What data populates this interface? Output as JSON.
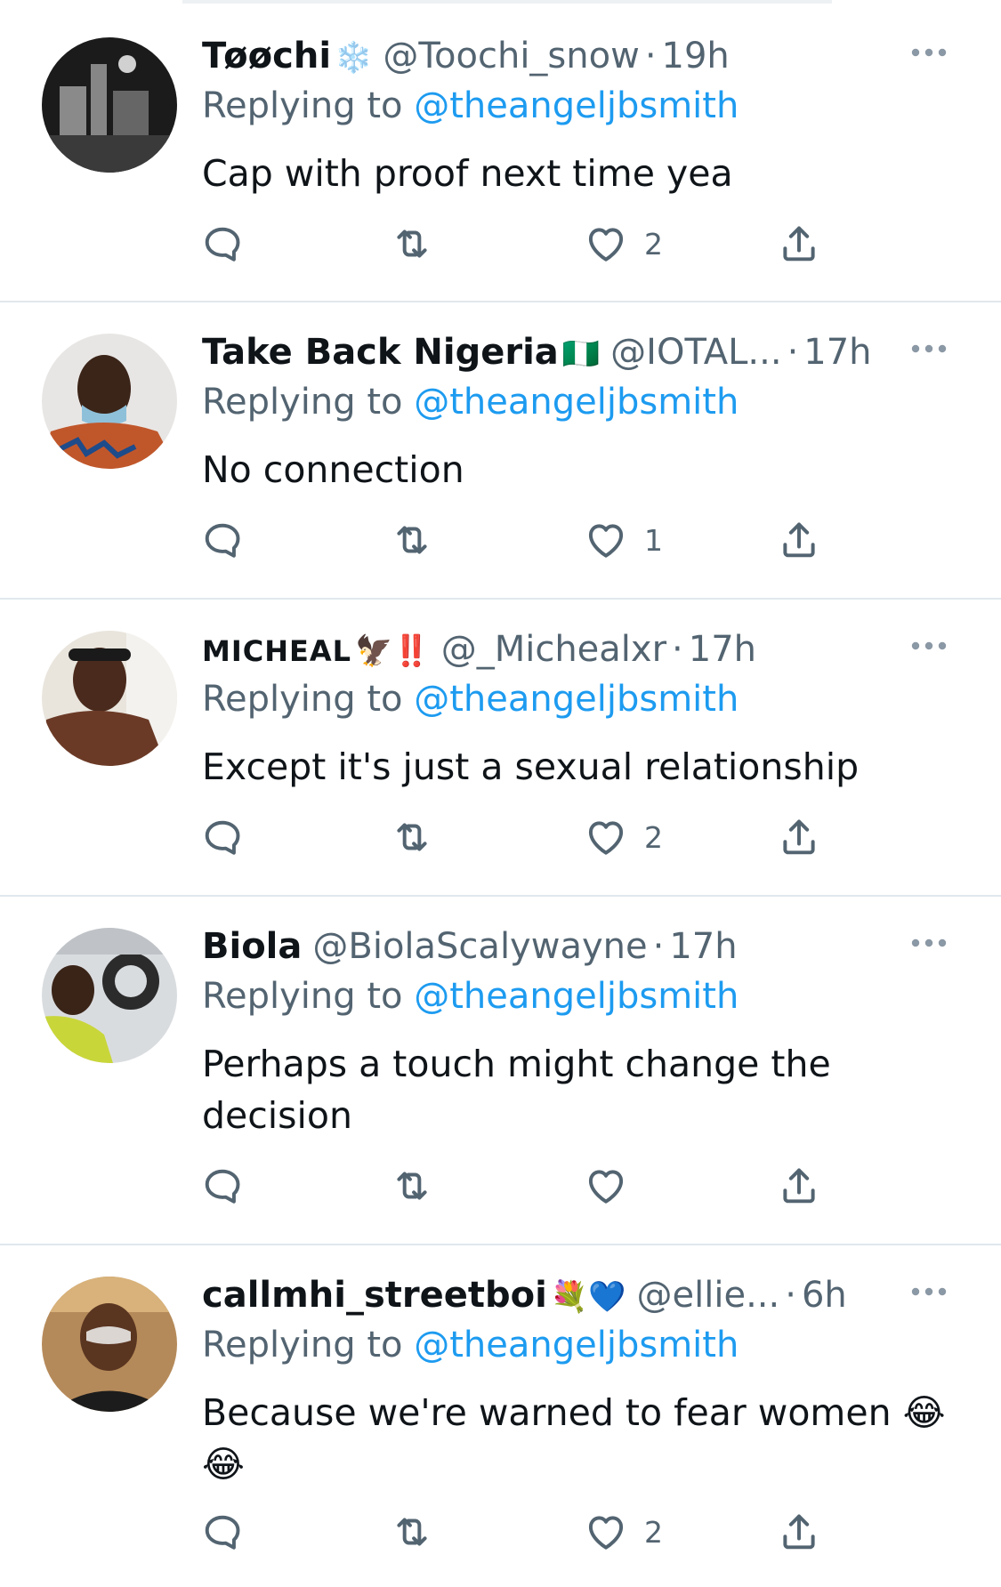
{
  "tweets": [
    {
      "name": "Tøøchi",
      "name_emoji": "❄️",
      "handle": "@Toochi_snow",
      "sep": "·",
      "time": "19h",
      "replying_label": "Replying to",
      "replying_to": "@theangeljbsmith",
      "text": "Cap with proof next time yea",
      "likes": "2"
    },
    {
      "name": "Take Back Nigeria",
      "name_emoji": "🇳🇬",
      "handle": "@IOTAL...",
      "sep": "·",
      "time": "17h",
      "replying_label": "Replying to",
      "replying_to": "@theangeljbsmith",
      "text": "No connection",
      "likes": "1"
    },
    {
      "name": "MICHEAL",
      "name_emoji": "🦅‼️",
      "handle": "@_Michealxr",
      "sep": "·",
      "time": "17h",
      "replying_label": "Replying to",
      "replying_to": "@theangeljbsmith",
      "text": "Except it's just a sexual relationship",
      "likes": "2"
    },
    {
      "name": "Biola",
      "name_emoji": "",
      "handle": "@BiolaScalywayne",
      "sep": "·",
      "time": "17h",
      "replying_label": "Replying to",
      "replying_to": "@theangeljbsmith",
      "text": "Perhaps a touch might change the decision",
      "likes": ""
    },
    {
      "name": "callmhi_streetboi",
      "name_emoji": "💐💙",
      "handle": "@ellie...",
      "sep": "·",
      "time": "6h",
      "replying_label": "Replying to",
      "replying_to": "@theangeljbsmith",
      "text": "Because we're warned to fear women 😂 😂",
      "likes": "2"
    }
  ],
  "colors": {
    "text": "#0f1419",
    "secondary": "#536471",
    "link": "#1d9bf0",
    "divider": "#e1e8ed"
  },
  "icons": {
    "reply": "reply-bubble-icon",
    "retweet": "retweet-icon",
    "like": "heart-icon",
    "share": "share-upload-icon",
    "more": "more-dots-icon"
  }
}
